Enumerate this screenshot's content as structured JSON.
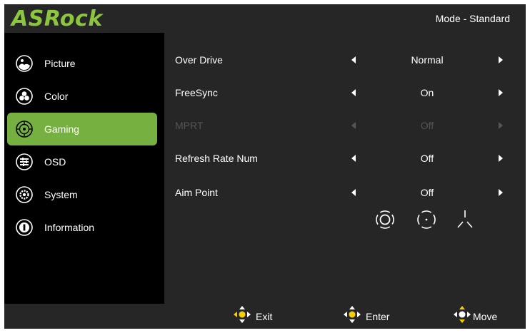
{
  "header": {
    "logo_text": "ASRock",
    "mode": "Mode - Standard",
    "brand_color": "#8cc63f"
  },
  "sidebar": {
    "items": [
      {
        "label": "Picture",
        "icon": "picture-icon",
        "active": false
      },
      {
        "label": "Color",
        "icon": "color-icon",
        "active": false
      },
      {
        "label": "Gaming",
        "icon": "gaming-icon",
        "active": true
      },
      {
        "label": "OSD",
        "icon": "osd-icon",
        "active": false
      },
      {
        "label": "System",
        "icon": "gear-icon",
        "active": false
      },
      {
        "label": "Information",
        "icon": "info-icon",
        "active": false
      }
    ],
    "active_color": "#76b041"
  },
  "settings": [
    {
      "label": "Over Drive",
      "value": "Normal",
      "enabled": true
    },
    {
      "label": "FreeSync",
      "value": "On",
      "enabled": true
    },
    {
      "label": "MPRT",
      "value": "Off",
      "enabled": false
    },
    {
      "label": "Refresh Rate Num",
      "value": "Off",
      "enabled": true
    },
    {
      "label": "Aim Point",
      "value": "Off",
      "enabled": true
    }
  ],
  "aim_point_options": [
    "crosshair-circle-icon",
    "crosshair-dot-icon",
    "crosshair-tri-icon"
  ],
  "footer": {
    "exit_label": "Exit",
    "enter_label": "Enter",
    "move_label": "Move",
    "nav_accent_color": "#f5d000"
  }
}
